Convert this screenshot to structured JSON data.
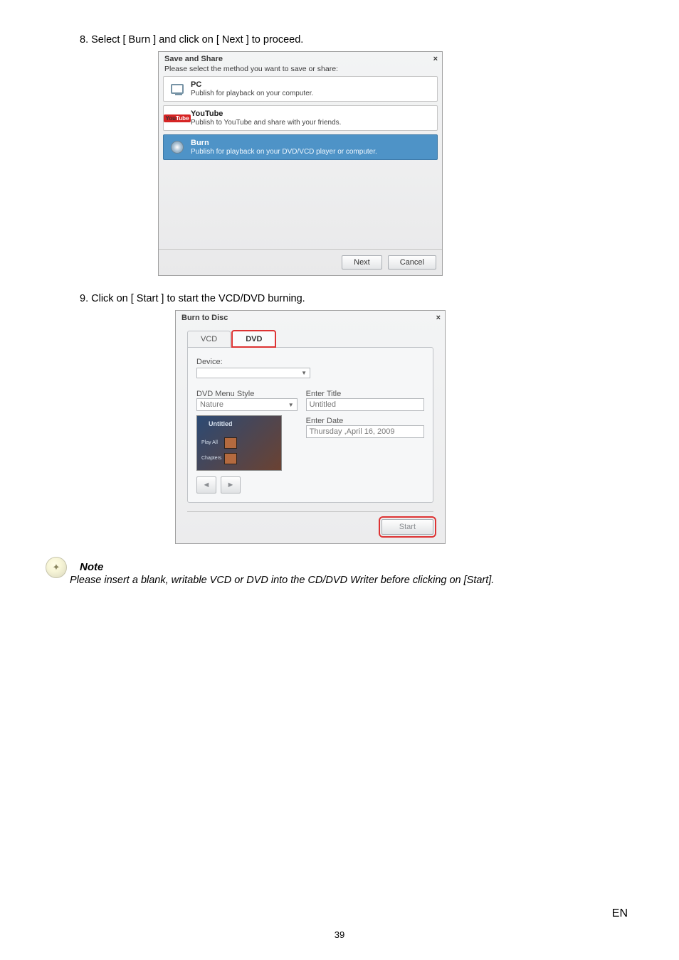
{
  "step8": "8. Select [ Burn ] and click on [ Next ] to proceed.",
  "step9": "9. Click on [ Start ] to start the VCD/DVD burning.",
  "dlg1": {
    "title": "Save and Share",
    "close": "×",
    "subtitle": "Please select the method you want to save or share:",
    "opt_pc": {
      "title": "PC",
      "desc": "Publish for playback on your computer."
    },
    "opt_yt": {
      "title": "YouTube",
      "desc": "Publish to YouTube and share with your friends."
    },
    "opt_burn": {
      "title": "Burn",
      "desc": "Publish for playback on your DVD/VCD player or computer."
    },
    "next": "Next",
    "cancel": "Cancel",
    "yt_label_black": "You",
    "yt_label_red": "Tube"
  },
  "dlg2": {
    "title": "Burn to Disc",
    "close": "×",
    "tab_vcd": "VCD",
    "tab_dvd": "DVD",
    "device": "Device:",
    "menuStyle": "DVD Menu Style",
    "menuValue": "Nature",
    "enterTitle": "Enter Title",
    "titleValue": "Untitled",
    "enterDate": "Enter Date",
    "dateValue": "Thursday ,April 16, 2009",
    "thumb_title": "Untitled",
    "thumb_play": "Play All",
    "thumb_chap": "Chapters",
    "nav_prev": "◄",
    "nav_next": "►",
    "start": "Start"
  },
  "note": {
    "head": "Note",
    "body": "Please insert a blank, writable VCD or DVD into the CD/DVD Writer before clicking on [Start].",
    "glyph": "✦"
  },
  "page_num": "39",
  "lang": "EN"
}
